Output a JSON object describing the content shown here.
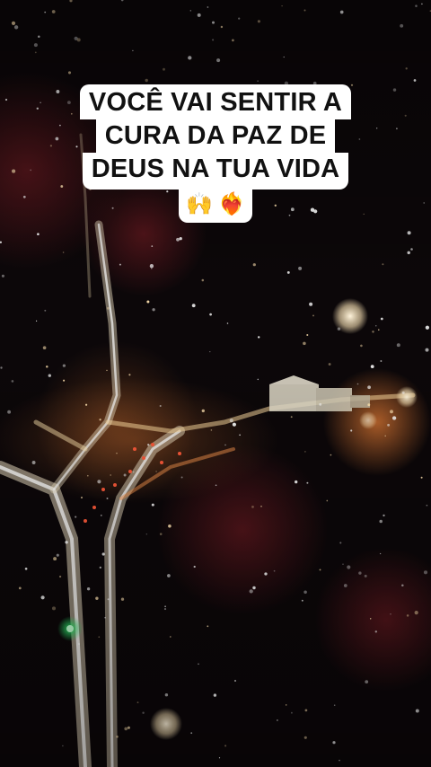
{
  "caption": {
    "line1": "VOCÊ VAI SENTIR A",
    "line2": "CURA DA PAZ DE",
    "line3": "DEUS NA TUA VIDA",
    "emoji_raised_hands": "🙌",
    "emoji_heart_on_fire": "❤️‍🔥"
  },
  "scene": {
    "description_kind": "aerial-night-city-road",
    "colors": {
      "sky": "#0c0709",
      "road_light": "#f4e6c8",
      "warm_glow": "#ff8a3a",
      "bokeh": "#7a1e24",
      "green_light": "#2ee66b"
    }
  }
}
